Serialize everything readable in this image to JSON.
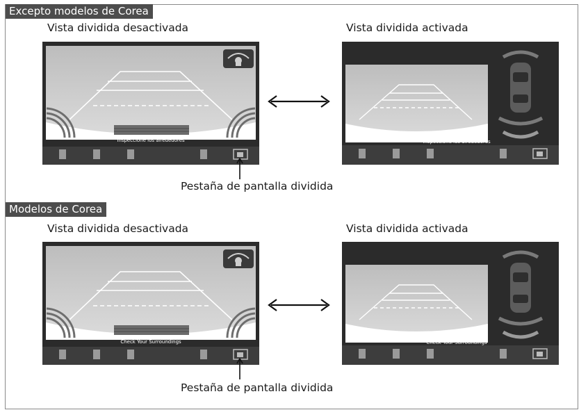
{
  "sections": [
    {
      "label": "Excepto modelos de Corea",
      "off_caption": "Vista dividida desactivada",
      "on_caption": "Vista dividida activada",
      "off_warning": "Inspeccione los alrededores",
      "on_warning": "Inspeccione los alrededores",
      "callout": "Pestaña de pantalla dividida"
    },
    {
      "label": "Modelos de Corea",
      "off_caption": "Vista dividida desactivada",
      "on_caption": "Vista dividida activada",
      "off_warning": "Check Your Surroundings",
      "on_warning": "Check Your Surroundings",
      "callout": "Pestaña de pantalla dividida"
    }
  ],
  "icons": {
    "swap_arrow": "double-headed-arrow",
    "sensor_icon": "parking-sensor-icon",
    "split_tab_icon": "split-screen-tab-icon"
  },
  "colors": {
    "label_bg": "#4d4d4d",
    "screen_bg": "#2b2b2b",
    "guide_lines": "#ffffff",
    "sensor_arc": "#6e6e6e"
  }
}
